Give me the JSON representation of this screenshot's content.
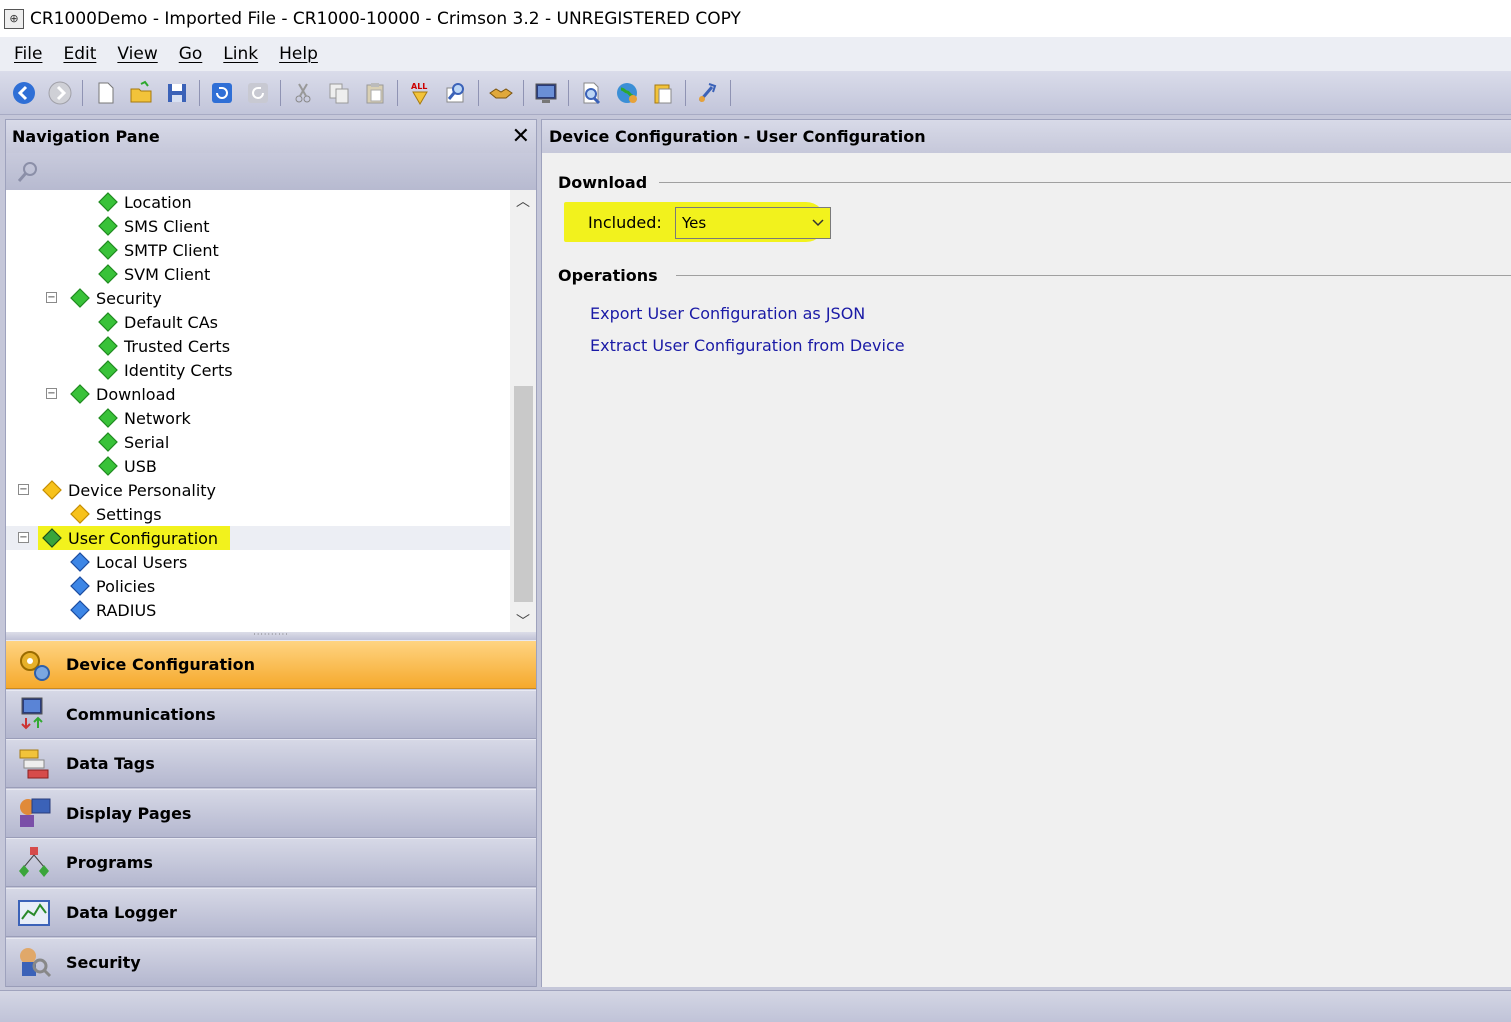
{
  "window": {
    "title": "CR1000Demo - Imported File - CR1000-10000 - Crimson 3.2 - UNREGISTERED COPY",
    "icon": "app-icon"
  },
  "menu": [
    "File",
    "Edit",
    "View",
    "Go",
    "Link",
    "Help"
  ],
  "toolbar": {
    "groups": [
      [
        "back-icon",
        "forward-icon"
      ],
      [
        "new-file-icon",
        "open-file-icon",
        "save-icon"
      ],
      [
        "undo-icon",
        "redo-icon"
      ],
      [
        "cut-icon",
        "copy-icon",
        "paste-icon"
      ],
      [
        "find-all-icon",
        "find-icon"
      ],
      [
        "handshake-icon"
      ],
      [
        "monitor-icon"
      ],
      [
        "inspect-icon",
        "web-icon",
        "clipboard-icon"
      ],
      [
        "link-icon"
      ]
    ]
  },
  "nav": {
    "title": "Navigation Pane",
    "tree": [
      {
        "label": "Location",
        "level": 3,
        "color": "green"
      },
      {
        "label": "SMS Client",
        "level": 3,
        "color": "green"
      },
      {
        "label": "SMTP Client",
        "level": 3,
        "color": "green"
      },
      {
        "label": "SVM Client",
        "level": 3,
        "color": "green"
      },
      {
        "label": "Security",
        "level": 2,
        "color": "green",
        "expander": true
      },
      {
        "label": "Default CAs",
        "level": 3,
        "color": "green"
      },
      {
        "label": "Trusted Certs",
        "level": 3,
        "color": "green"
      },
      {
        "label": "Identity Certs",
        "level": 3,
        "color": "green"
      },
      {
        "label": "Download",
        "level": 2,
        "color": "green",
        "expander": true
      },
      {
        "label": "Network",
        "level": 3,
        "color": "green"
      },
      {
        "label": "Serial",
        "level": 3,
        "color": "green"
      },
      {
        "label": "USB",
        "level": 3,
        "color": "green"
      },
      {
        "label": "Device Personality",
        "level": 1,
        "color": "yellow",
        "expander": true
      },
      {
        "label": "Settings",
        "level": 2,
        "color": "yellow"
      },
      {
        "label": "User Configuration",
        "level": 1,
        "color": "green-dark",
        "expander": true,
        "selected": true
      },
      {
        "label": "Local Users",
        "level": 2,
        "color": "blue"
      },
      {
        "label": "Policies",
        "level": 2,
        "color": "blue"
      },
      {
        "label": "RADIUS",
        "level": 2,
        "color": "blue"
      }
    ],
    "categories": [
      {
        "label": "Device Configuration",
        "icon": "gears-icon",
        "active": true
      },
      {
        "label": "Communications",
        "icon": "communications-icon"
      },
      {
        "label": "Data Tags",
        "icon": "tags-icon"
      },
      {
        "label": "Display Pages",
        "icon": "display-pages-icon"
      },
      {
        "label": "Programs",
        "icon": "programs-icon"
      },
      {
        "label": "Data Logger",
        "icon": "logger-icon"
      },
      {
        "label": "Security",
        "icon": "security-icon"
      }
    ]
  },
  "content": {
    "header": "Device Configuration - User Configuration",
    "download_group": "Download",
    "included_label": "Included:",
    "included_value": "Yes",
    "operations_group": "Operations",
    "links": [
      "Export User Configuration as JSON",
      "Extract User Configuration from Device"
    ]
  },
  "colors": {
    "highlight": "#f2f21d",
    "active_category": "#f5a92c",
    "link": "#1a1aa6",
    "green": "#2fb22f",
    "yellow": "#f7c21b",
    "blue": "#2a6fd6"
  }
}
